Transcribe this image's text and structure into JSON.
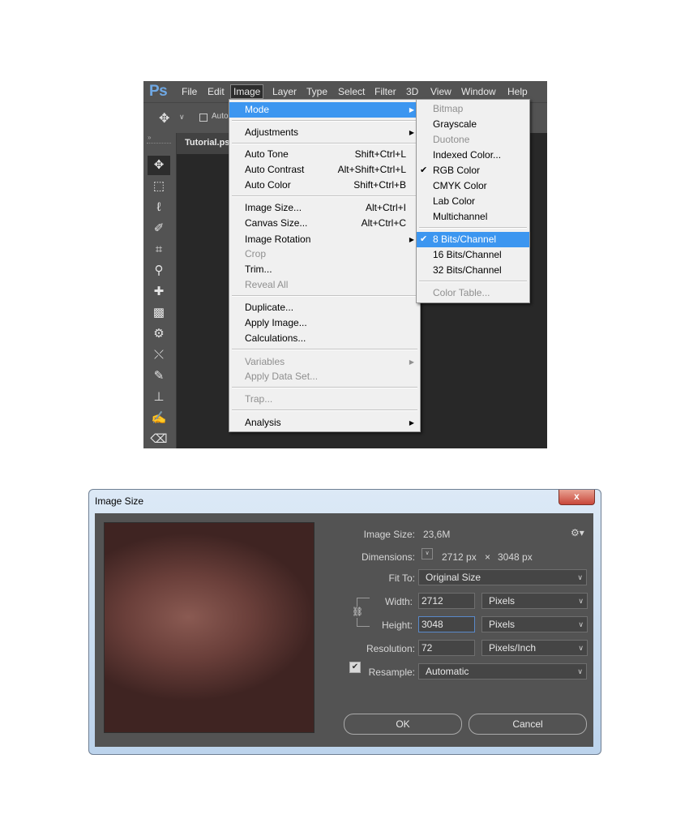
{
  "photoshop": {
    "logo": "Ps",
    "menubar": [
      "File",
      "Edit",
      "Image",
      "Layer",
      "Type",
      "Select",
      "Filter",
      "3D",
      "View",
      "Window",
      "Help"
    ],
    "options_bar": {
      "auto_label": "Auto"
    },
    "document_tab": "Tutorial.ps",
    "image_menu": {
      "mode": "Mode",
      "adjustments": "Adjustments",
      "auto_tone": "Auto Tone",
      "auto_tone_sc": "Shift+Ctrl+L",
      "auto_contrast": "Auto Contrast",
      "auto_contrast_sc": "Alt+Shift+Ctrl+L",
      "auto_color": "Auto Color",
      "auto_color_sc": "Shift+Ctrl+B",
      "image_size": "Image Size...",
      "image_size_sc": "Alt+Ctrl+I",
      "canvas_size": "Canvas Size...",
      "canvas_size_sc": "Alt+Ctrl+C",
      "image_rotation": "Image Rotation",
      "crop": "Crop",
      "trim": "Trim...",
      "reveal_all": "Reveal All",
      "duplicate": "Duplicate...",
      "apply_image": "Apply Image...",
      "calculations": "Calculations...",
      "variables": "Variables",
      "apply_data_set": "Apply Data Set...",
      "trap": "Trap...",
      "analysis": "Analysis"
    },
    "mode_submenu": {
      "bitmap": "Bitmap",
      "grayscale": "Grayscale",
      "duotone": "Duotone",
      "indexed_color": "Indexed Color...",
      "rgb_color": "RGB Color",
      "cmyk_color": "CMYK Color",
      "lab_color": "Lab Color",
      "multichannel": "Multichannel",
      "bits8": "8 Bits/Channel",
      "bits16": "16 Bits/Channel",
      "bits32": "32 Bits/Channel",
      "color_table": "Color Table..."
    },
    "colors": {
      "highlight": "#3c96f0",
      "panel": "#535353",
      "canvas": "#282828"
    }
  },
  "dialog": {
    "title": "Image Size",
    "close_glyph": "x",
    "image_size_label": "Image Size:",
    "image_size_value": "23,6M",
    "dimensions_label": "Dimensions:",
    "dim_width": "2712 px",
    "dim_x": "×",
    "dim_height": "3048 px",
    "fit_to_label": "Fit To:",
    "fit_to_value": "Original Size",
    "width_label": "Width:",
    "width_value": "2712",
    "width_unit": "Pixels",
    "height_label": "Height:",
    "height_value": "3048",
    "height_unit": "Pixels",
    "resolution_label": "Resolution:",
    "resolution_value": "72",
    "resolution_unit": "Pixels/Inch",
    "resample_label": "Resample:",
    "resample_value": "Automatic",
    "ok_label": "OK",
    "cancel_label": "Cancel"
  }
}
